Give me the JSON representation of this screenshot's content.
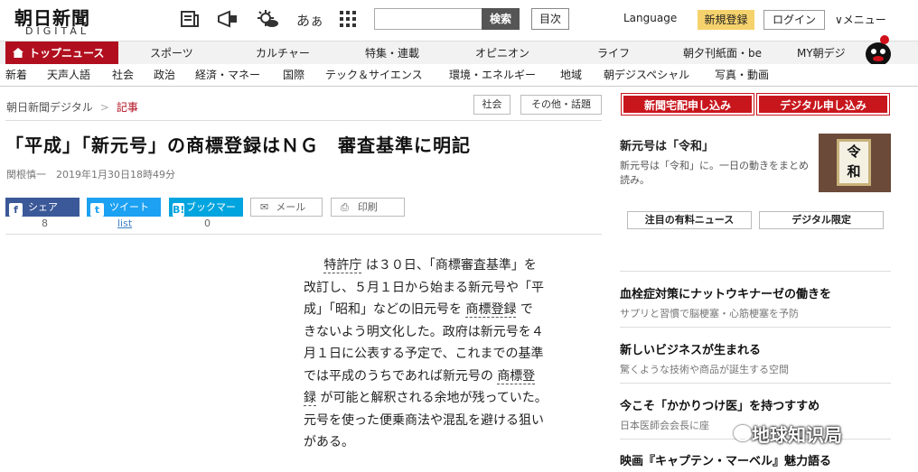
{
  "header": {
    "logo_jp": "朝日新聞",
    "logo_en": "DIGITAL",
    "search_button": "検索",
    "index_button": "目次",
    "language": "Language",
    "register": "新規登録",
    "login": "ログイン",
    "menu": "∨メニュー"
  },
  "nav_primary": {
    "top_news": "トップニュース",
    "items": [
      "スポーツ",
      "カルチャー",
      "特集・連載",
      "オピニオン",
      "ライフ",
      "朝夕刊紙面・be",
      "MY朝デジ"
    ]
  },
  "nav_secondary": {
    "items": [
      "新着",
      "天声人語",
      "社会",
      "政治",
      "経済・マネー",
      "国際",
      "テック＆サイエンス",
      "環境・エネルギー",
      "地域",
      "朝デジスペシャル",
      "写真・動画"
    ]
  },
  "breadcrumb": {
    "home": "朝日新聞デジタル",
    "separator": ">",
    "current": "記事"
  },
  "tags": [
    "社会",
    "その他・話題"
  ],
  "article": {
    "title": "「平成」「新元号」の商標登録はＮＧ　審査基準に明記",
    "byline": "関根慎一　2019年1月30日18時49分",
    "share": {
      "facebook": "シェア",
      "facebook_count": "8",
      "twitter": "ツイート",
      "twitter_count": "list",
      "hatena": "ブックマーク",
      "hatena_count": "0",
      "mail": "メール",
      "print": "印刷"
    },
    "body": {
      "l1a": "特許庁",
      "l1b": "は３０日、「商標審査基準」を",
      "l2": "改訂し、５月１日から始まる新元号や「平",
      "l3": "成」「昭和」などの旧元号を",
      "l3_link": "商標登録",
      "l3b": "で",
      "l4": "きないよう明文化した。政府は新元号を４",
      "l5": "月１日に公表する予定で、これまでの基準",
      "l6": "では平成のうちであれば新元号の",
      "l6_link": "商標登",
      "l7_link": "録",
      "l7": "が可能と解釈される余地が残っていた。",
      "l8": "元号を使った便乗商法や混乱を避ける狙い",
      "l9": "がある。"
    }
  },
  "sidebar": {
    "subscribe_paper": "新聞宅配申し込み",
    "subscribe_digital": "デジタル申し込み",
    "feature": {
      "title": "新元号は「令和」",
      "desc": "新元号は「令和」に。一日の動きをまとめ読み。",
      "image_text_1": "令",
      "image_text_2": "和"
    },
    "paid_news": "注目の有料ニュース",
    "digital_only": "デジタル限定",
    "items": [
      {
        "title": "血栓症対策にナットウキナーゼの働きを",
        "desc": "サプリと習慣で脳梗塞・心筋梗塞を予防"
      },
      {
        "title": "新しいビジネスが生まれる",
        "desc": "驚くような技術や商品が誕生する空間"
      },
      {
        "title": "今こそ「かかりつけ医」を持つすすめ",
        "desc": "日本医師会会長に座"
      },
      {
        "title": "映画『キャプテン・マーベル』魅力語る",
        "desc": ""
      }
    ]
  },
  "watermark": "地球知识局",
  "colors": {
    "brand_red": "#b10f1f",
    "facebook": "#3b5998",
    "twitter": "#1da1f2",
    "hatena": "#00a4de",
    "register": "#f6d26c"
  }
}
